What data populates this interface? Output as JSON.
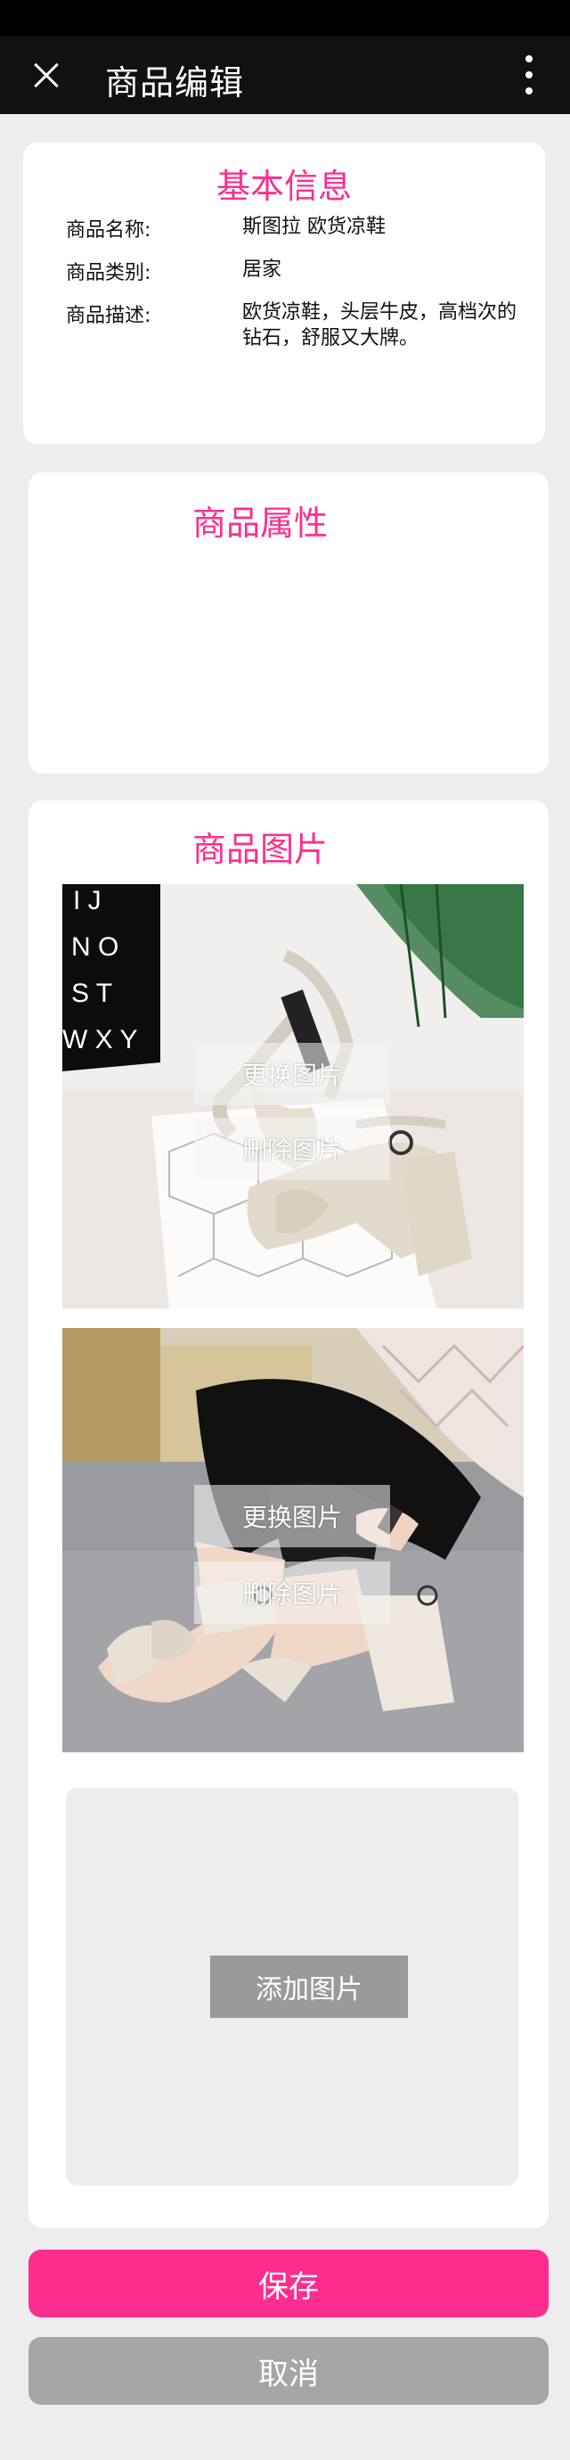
{
  "app_bar": {
    "title": "商品编辑",
    "close_icon": "close-icon",
    "more_icon": "more-vertical-icon"
  },
  "basic_info": {
    "title": "基本信息",
    "rows": [
      {
        "label": "商品名称:",
        "value": "斯图拉 欧货凉鞋"
      },
      {
        "label": "商品类别:",
        "value": "居家"
      },
      {
        "label": "商品描述:",
        "value": "欧货凉鞋，头层牛皮，高档次的钻石，舒服又大牌。"
      }
    ]
  },
  "attributes": {
    "title": "商品属性"
  },
  "images": {
    "title": "商品图片",
    "photos": [
      {
        "replace_label": "更换图片",
        "delete_label": "删除图片"
      },
      {
        "replace_label": "更换图片",
        "delete_label": "删除图片"
      }
    ],
    "add_label": "添加图片"
  },
  "actions": {
    "save_label": "保存",
    "cancel_label": "取消"
  },
  "colors": {
    "accent": "#ff2d8f",
    "save_button": "#ff2d8f",
    "cancel_button": "#a6a6a6",
    "app_bar": "#111111",
    "page_bg": "#ededed"
  }
}
